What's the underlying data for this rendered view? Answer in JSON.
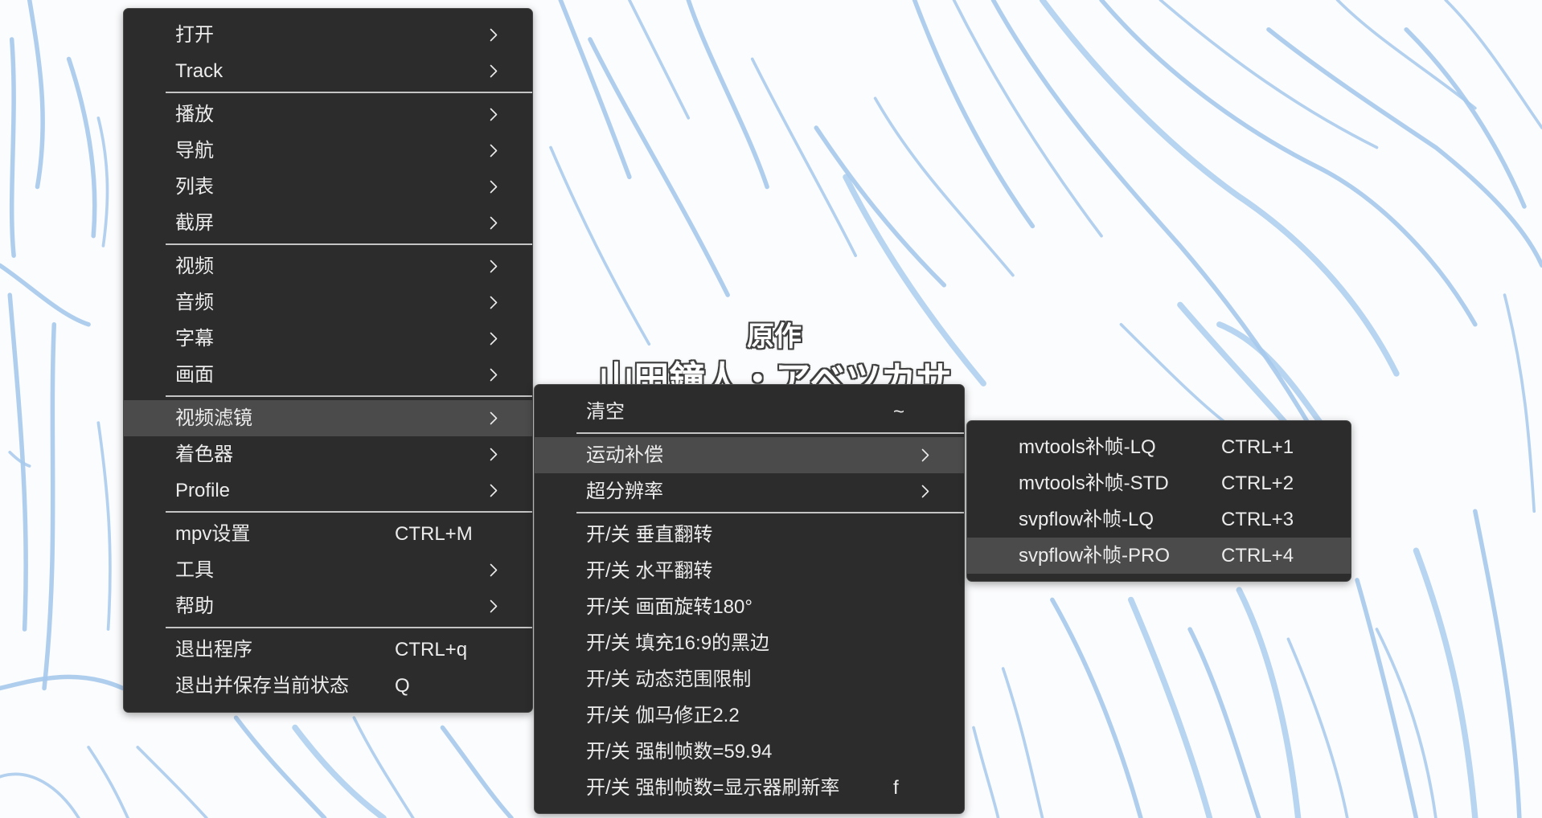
{
  "colors": {
    "page_bg": "#fbfcfd",
    "sketch_stroke": "#a6c9ec",
    "menu_bg": "#2c2c2c",
    "menu_border": "#474747",
    "menu_highlight": "#4b4b4b",
    "menu_text": "#ececec",
    "separator": "#c4c4c4",
    "credit_outline": "#3f3f3f"
  },
  "icons": {
    "submenu_indicator": "chevron-right-icon"
  },
  "video_overlay": {
    "credit_title": "原作",
    "credit_names": "山田鐘人・アベツカサ"
  },
  "main_menu": {
    "items": [
      {
        "label": "打开",
        "submenu": true
      },
      {
        "label": "Track",
        "submenu": true
      },
      {
        "label": "播放",
        "submenu": true
      },
      {
        "label": "导航",
        "submenu": true
      },
      {
        "label": "列表",
        "submenu": true
      },
      {
        "label": "截屏",
        "submenu": true
      },
      {
        "label": "视频",
        "submenu": true
      },
      {
        "label": "音频",
        "submenu": true
      },
      {
        "label": "字幕",
        "submenu": true
      },
      {
        "label": "画面",
        "submenu": true
      },
      {
        "label": "视频滤镜",
        "submenu": true,
        "active": true
      },
      {
        "label": "着色器",
        "submenu": true
      },
      {
        "label": "Profile",
        "submenu": true
      },
      {
        "label": "mpv设置",
        "shortcut": "CTRL+M"
      },
      {
        "label": "工具",
        "submenu": true
      },
      {
        "label": "帮助",
        "submenu": true
      },
      {
        "label": "退出程序",
        "shortcut": "CTRL+q"
      },
      {
        "label": "退出并保存当前状态",
        "shortcut": "Q"
      }
    ]
  },
  "video_filters_menu": {
    "items": [
      {
        "label": "清空",
        "shortcut": "~"
      },
      {
        "label": "运动补偿",
        "submenu": true,
        "active": true
      },
      {
        "label": "超分辨率",
        "submenu": true
      },
      {
        "label": "开/关 垂直翻转"
      },
      {
        "label": "开/关 水平翻转"
      },
      {
        "label": "开/关 画面旋转180°"
      },
      {
        "label": "开/关 填充16:9的黑边"
      },
      {
        "label": "开/关 动态范围限制"
      },
      {
        "label": "开/关 伽马修正2.2"
      },
      {
        "label": "开/关 强制帧数=59.94"
      },
      {
        "label": "开/关 强制帧数=显示器刷新率",
        "shortcut": "f"
      }
    ]
  },
  "motion_compensation_menu": {
    "items": [
      {
        "label": "mvtools补帧-LQ",
        "shortcut": "CTRL+1"
      },
      {
        "label": "mvtools补帧-STD",
        "shortcut": "CTRL+2"
      },
      {
        "label": "svpflow补帧-LQ",
        "shortcut": "CTRL+3"
      },
      {
        "label": "svpflow补帧-PRO",
        "shortcut": "CTRL+4",
        "active": true
      }
    ]
  }
}
